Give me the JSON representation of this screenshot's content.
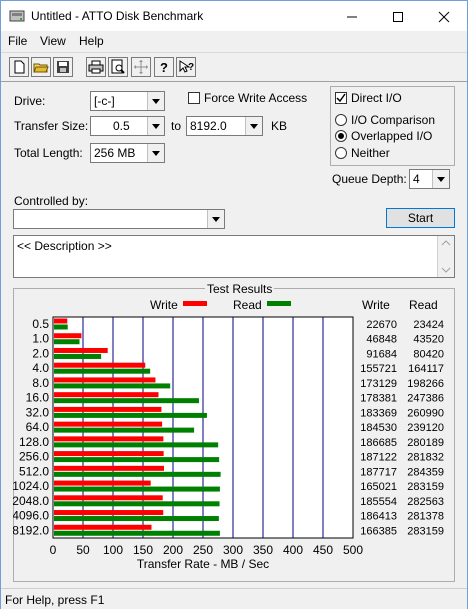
{
  "window": {
    "title": "Untitled - ATTO Disk Benchmark"
  },
  "menu": {
    "file": "File",
    "view": "View",
    "help": "Help"
  },
  "form": {
    "drive_label": "Drive:",
    "drive_value": "[-c-]",
    "transfer_size_label": "Transfer Size:",
    "transfer_from": "0.5",
    "to_label": "to",
    "transfer_to": "8192.0",
    "kb_label": "KB",
    "total_length_label": "Total Length:",
    "total_length_value": "256 MB",
    "force_write_label": "Force Write Access",
    "force_write_checked": false,
    "direct_io_label": "Direct I/O",
    "direct_io_checked": true,
    "io_comparison_label": "I/O Comparison",
    "overlapped_io_label": "Overlapped I/O",
    "neither_label": "Neither",
    "selected_io_mode": "Overlapped I/O",
    "queue_depth_label": "Queue Depth:",
    "queue_depth_value": "4",
    "controlled_by_label": "Controlled by:",
    "controlled_by_value": "",
    "start_button": "Start",
    "description": "<< Description >>"
  },
  "results": {
    "group_title": "Test Results",
    "write_legend": "Write",
    "read_legend": "Read",
    "write_col_header": "Write",
    "read_col_header": "Read",
    "xlabel": "Transfer Rate - MB / Sec",
    "write_color": "#ff0000",
    "read_color": "#008000",
    "grid_color": "#000080"
  },
  "chart_data": {
    "type": "bar",
    "orientation": "horizontal",
    "categories": [
      "0.5",
      "1.0",
      "2.0",
      "4.0",
      "8.0",
      "16.0",
      "32.0",
      "64.0",
      "128.0",
      "256.0",
      "512.0",
      "1024.0",
      "2048.0",
      "4096.0",
      "8192.0"
    ],
    "series": [
      {
        "name": "Write",
        "values": [
          22670,
          46848,
          91684,
          155721,
          173129,
          178381,
          183369,
          184530,
          186685,
          187122,
          187717,
          165021,
          185554,
          186413,
          166385
        ]
      },
      {
        "name": "Read",
        "values": [
          23424,
          43520,
          80420,
          164117,
          198266,
          247386,
          260990,
          239120,
          280189,
          281832,
          284359,
          283159,
          282563,
          281378,
          283159
        ]
      }
    ],
    "xlim": [
      0,
      500
    ],
    "xticks": [
      "0",
      "50",
      "100",
      "150",
      "200",
      "250",
      "300",
      "350",
      "400",
      "450",
      "500"
    ],
    "xlabel": "Transfer Rate - MB / Sec",
    "grid": true,
    "legend": "top"
  },
  "status": {
    "text": "For Help, press F1"
  }
}
